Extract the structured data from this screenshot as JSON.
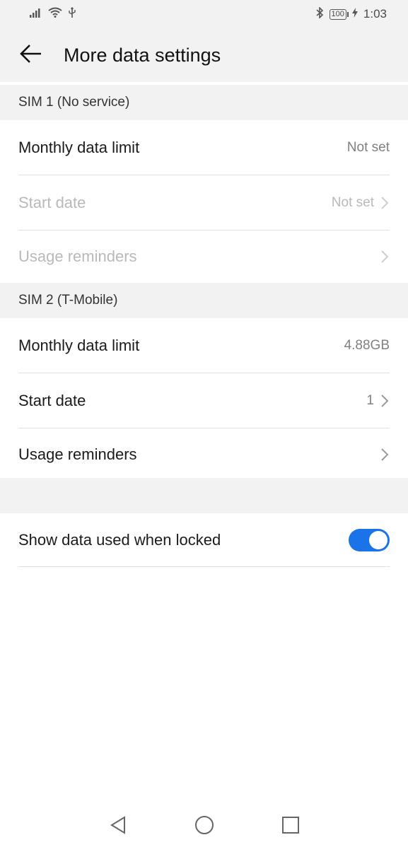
{
  "status_bar": {
    "battery": "100",
    "time": "1:03",
    "icons": [
      "signal-icon",
      "wifi-icon",
      "usb-icon",
      "bluetooth-icon",
      "battery-icon",
      "charging-icon"
    ]
  },
  "header": {
    "title": "More data settings",
    "back_icon": "arrow-left-icon"
  },
  "sim1": {
    "header": "SIM 1 (No service)",
    "rows": [
      {
        "label": "Monthly data limit",
        "value": "Not set",
        "enabled": true
      },
      {
        "label": "Start date",
        "value": "Not set",
        "enabled": false
      },
      {
        "label": "Usage reminders",
        "value": "",
        "enabled": false
      }
    ]
  },
  "sim2": {
    "header": "SIM 2 (T-Mobile)",
    "rows": [
      {
        "label": "Monthly data limit",
        "value": "4.88GB",
        "enabled": true
      },
      {
        "label": "Start date",
        "value": "1",
        "enabled": true
      },
      {
        "label": "Usage reminders",
        "value": "",
        "enabled": true
      }
    ]
  },
  "lock_setting": {
    "label": "Show data used when locked",
    "toggle_on": true
  },
  "colors": {
    "accent": "#1a73e8",
    "section_bg": "#f2f2f2",
    "disabled_text": "#b9b9b9"
  },
  "nav_bar": {
    "icons": [
      "back-triangle-icon",
      "home-circle-icon",
      "recents-square-icon"
    ]
  }
}
